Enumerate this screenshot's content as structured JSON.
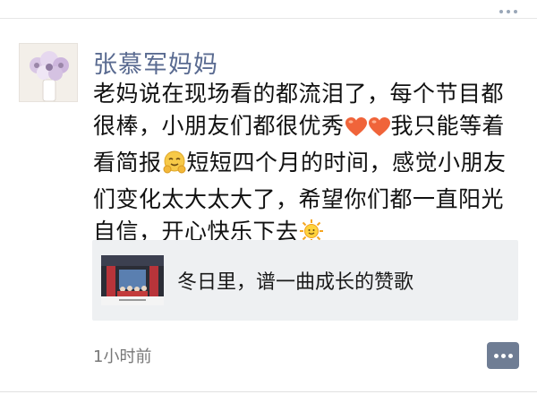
{
  "post": {
    "author": "张慕军妈妈",
    "text_parts": {
      "p1": "老妈说在现场看的都流泪了，每个节目都很棒，小朋友们都很优秀",
      "p2": "我只能等着看简报",
      "p3": "短短四个月的时间，感觉小朋友们变化太大太大了，希望你们都一直阳光自信，开心快乐下去"
    },
    "emojis": [
      "heart-icon",
      "heart-icon",
      "hugging-face-icon",
      "sun-icon"
    ],
    "link": {
      "title": "冬日里，谱一曲成长的赞歌"
    },
    "time": "1小时前"
  },
  "colors": {
    "author_name": "#5a6b91",
    "comment_button": "#6f7d94",
    "link_card_bg": "#eef0f2",
    "heart": "#f0643a"
  }
}
